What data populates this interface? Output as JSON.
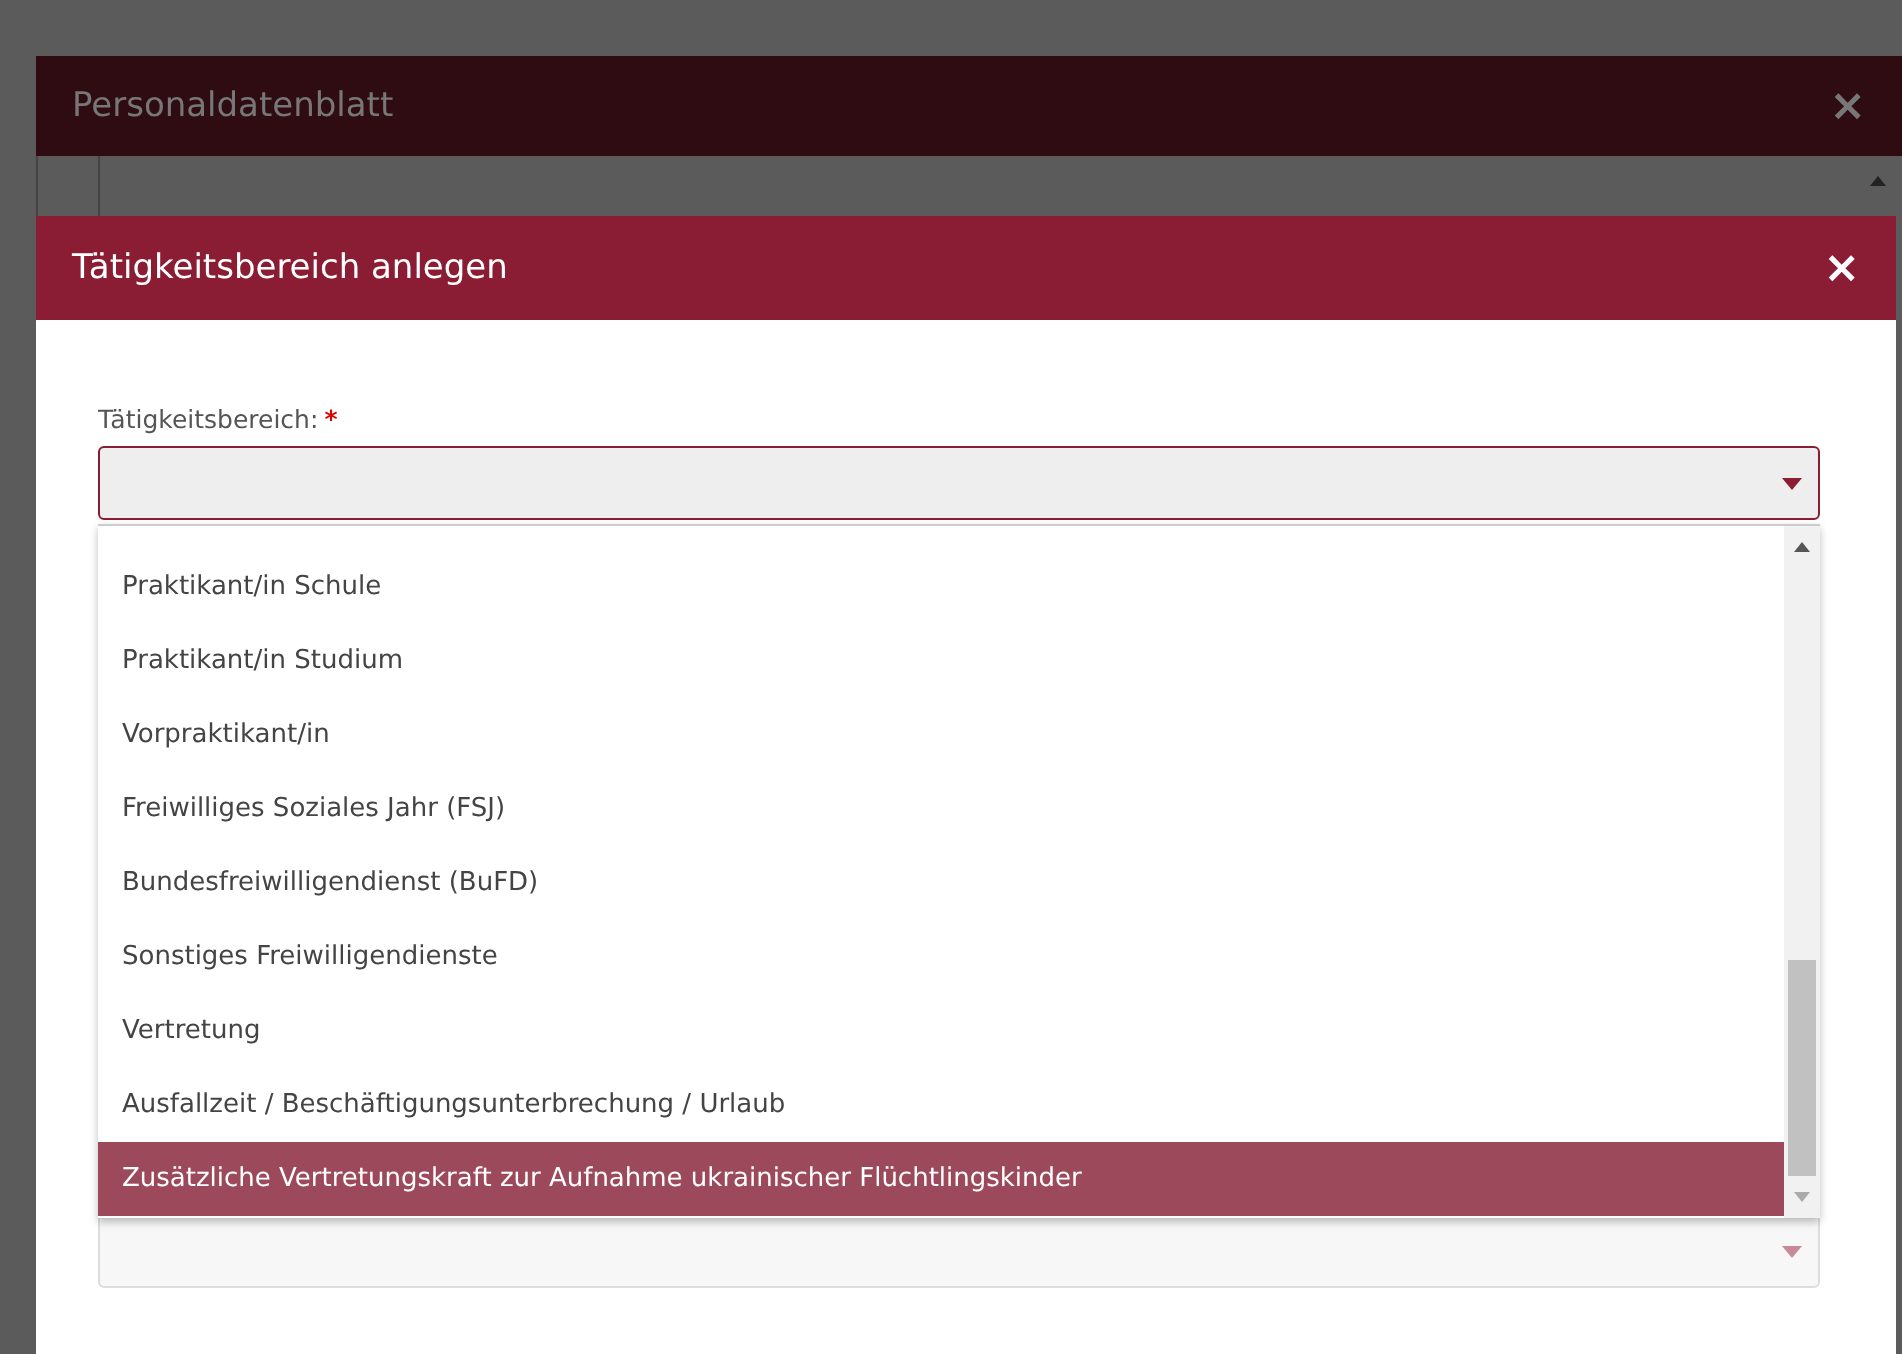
{
  "back_dialog": {
    "title": "Personaldatenblatt",
    "close": "×"
  },
  "dialog": {
    "title": "Tätigkeitsbereich anlegen",
    "close": "×"
  },
  "field": {
    "label": "Tätigkeitsbereich:",
    "required_mark": "*"
  },
  "options": [
    {
      "label": "Praktikant/in Schule",
      "selected": false
    },
    {
      "label": "Praktikant/in Studium",
      "selected": false
    },
    {
      "label": "Vorpraktikant/in",
      "selected": false
    },
    {
      "label": "Freiwilliges Soziales Jahr (FSJ)",
      "selected": false
    },
    {
      "label": "Bundesfreiwilligendienst (BuFD)",
      "selected": false
    },
    {
      "label": "Sonstiges Freiwilligendienste",
      "selected": false
    },
    {
      "label": "Vertretung",
      "selected": false
    },
    {
      "label": "Ausfallzeit / Beschäftigungsunterbrechung / Urlaub",
      "selected": false
    },
    {
      "label": "Zusätzliche Vertretungskraft zur Aufnahme ukrainischer Flüchtlingskinder",
      "selected": true
    }
  ]
}
